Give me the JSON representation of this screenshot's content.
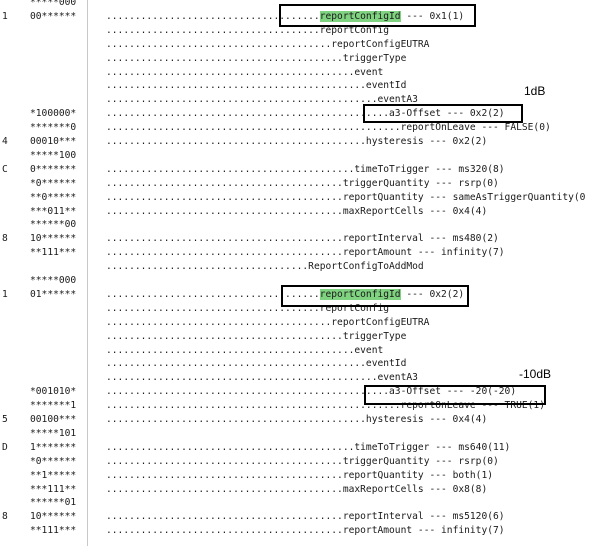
{
  "rows": [
    {
      "a": "",
      "b": "*****000",
      "dots": "",
      "label": "",
      "hl": ""
    },
    {
      "a": "1",
      "b": "00******",
      "dots": ".....................................",
      "label": " --- 0x1(1)",
      "hl": "reportConfigId"
    },
    {
      "a": "",
      "b": "",
      "dots": ".....................................",
      "label": "reportConfig",
      "hl": ""
    },
    {
      "a": "",
      "b": "",
      "dots": ".......................................",
      "label": "reportConfigEUTRA",
      "hl": ""
    },
    {
      "a": "",
      "b": "",
      "dots": ".........................................",
      "label": "triggerType",
      "hl": ""
    },
    {
      "a": "",
      "b": "",
      "dots": "...........................................",
      "label": "event",
      "hl": ""
    },
    {
      "a": "",
      "b": "",
      "dots": ".............................................",
      "label": "eventId",
      "hl": ""
    },
    {
      "a": "",
      "b": "",
      "dots": "...............................................",
      "label": "eventA3",
      "hl": ""
    },
    {
      "a": "",
      "b": "*100000*",
      "dots": ".................................................",
      "label": "a3-Offset --- 0x2(2)",
      "hl": ""
    },
    {
      "a": "",
      "b": "*******0",
      "dots": "...................................................",
      "label": "reportOnLeave --- FALSE(0)",
      "hl": ""
    },
    {
      "a": "4",
      "b": "00010***",
      "dots": ".............................................",
      "label": "hysteresis --- 0x2(2)",
      "hl": ""
    },
    {
      "a": "",
      "b": "*****100",
      "dots": "",
      "label": "",
      "hl": ""
    },
    {
      "a": "C",
      "b": "0*******",
      "dots": "...........................................",
      "label": "timeToTrigger --- ms320(8)",
      "hl": ""
    },
    {
      "a": "",
      "b": "*0******",
      "dots": ".........................................",
      "label": "triggerQuantity --- rsrp(0)",
      "hl": ""
    },
    {
      "a": "",
      "b": "**0*****",
      "dots": ".........................................",
      "label": "reportQuantity --- sameAsTriggerQuantity(0",
      "hl": ""
    },
    {
      "a": "",
      "b": "***011**",
      "dots": ".........................................",
      "label": "maxReportCells --- 0x4(4)",
      "hl": ""
    },
    {
      "a": "",
      "b": "******00",
      "dots": "",
      "label": "",
      "hl": ""
    },
    {
      "a": "8",
      "b": "10******",
      "dots": ".........................................",
      "label": "reportInterval --- ms480(2)",
      "hl": ""
    },
    {
      "a": "",
      "b": "**111***",
      "dots": ".........................................",
      "label": "reportAmount --- infinity(7)",
      "hl": ""
    },
    {
      "a": "",
      "b": "",
      "dots": "...................................",
      "label": "ReportConfigToAddMod",
      "hl": ""
    },
    {
      "a": "",
      "b": "*****000",
      "dots": "",
      "label": "",
      "hl": ""
    },
    {
      "a": "1",
      "b": "01******",
      "dots": ".....................................",
      "label": " --- 0x2(2)",
      "hl": "reportConfigId"
    },
    {
      "a": "",
      "b": "",
      "dots": ".....................................",
      "label": "reportConfig",
      "hl": ""
    },
    {
      "a": "",
      "b": "",
      "dots": ".......................................",
      "label": "reportConfigEUTRA",
      "hl": ""
    },
    {
      "a": "",
      "b": "",
      "dots": ".........................................",
      "label": "triggerType",
      "hl": ""
    },
    {
      "a": "",
      "b": "",
      "dots": "...........................................",
      "label": "event",
      "hl": ""
    },
    {
      "a": "",
      "b": "",
      "dots": ".............................................",
      "label": "eventId",
      "hl": ""
    },
    {
      "a": "",
      "b": "",
      "dots": "...............................................",
      "label": "eventA3",
      "hl": ""
    },
    {
      "a": "",
      "b": "*001010*",
      "dots": ".................................................",
      "label": "a3-Offset --- -20(-20)",
      "hl": ""
    },
    {
      "a": "",
      "b": "*******1",
      "dots": "...................................................",
      "label": "reportOnLeave --- TRUE(1)",
      "hl": ""
    },
    {
      "a": "5",
      "b": "00100***",
      "dots": ".............................................",
      "label": "hysteresis --- 0x4(4)",
      "hl": ""
    },
    {
      "a": "",
      "b": "*****101",
      "dots": "",
      "label": "",
      "hl": ""
    },
    {
      "a": "D",
      "b": "1*******",
      "dots": "...........................................",
      "label": "timeToTrigger --- ms640(11)",
      "hl": ""
    },
    {
      "a": "",
      "b": "*0******",
      "dots": ".........................................",
      "label": "triggerQuantity --- rsrp(0)",
      "hl": ""
    },
    {
      "a": "",
      "b": "**1*****",
      "dots": ".........................................",
      "label": "reportQuantity --- both(1)",
      "hl": ""
    },
    {
      "a": "",
      "b": "***111**",
      "dots": ".........................................",
      "label": "maxReportCells --- 0x8(8)",
      "hl": ""
    },
    {
      "a": "",
      "b": "******01",
      "dots": "",
      "label": "",
      "hl": ""
    },
    {
      "a": "8",
      "b": "10******",
      "dots": ".........................................",
      "label": "reportInterval --- ms5120(6)",
      "hl": ""
    },
    {
      "a": "",
      "b": "**111***",
      "dots": ".........................................",
      "label": "reportAmount --- infinity(7)",
      "hl": ""
    }
  ],
  "annotations": {
    "first_offset_note": "1dB",
    "second_offset_note": "-10dB"
  }
}
